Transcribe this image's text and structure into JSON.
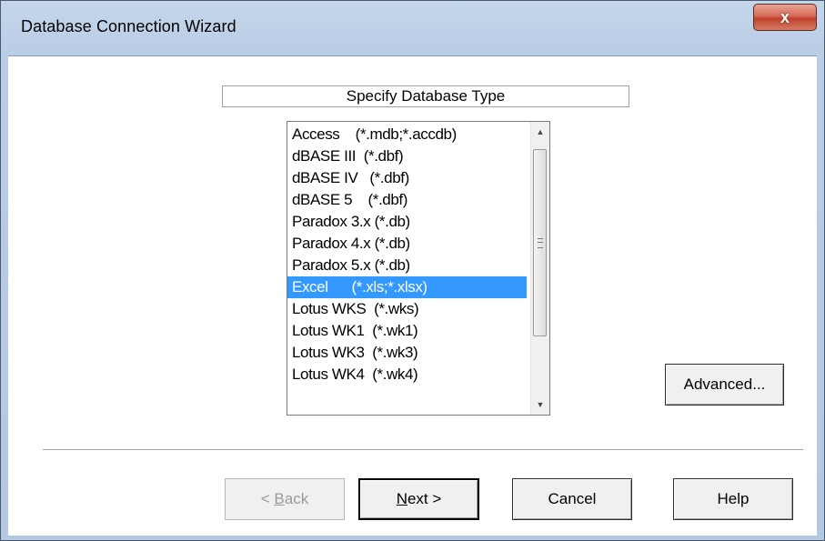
{
  "window": {
    "title": "Database Connection Wizard",
    "close_label": "x"
  },
  "step": {
    "heading": "Specify Database Type"
  },
  "db_types": [
    "Access    (*.mdb;*.accdb)",
    "dBASE III  (*.dbf)",
    "dBASE IV   (*.dbf)",
    "dBASE 5    (*.dbf)",
    "Paradox 3.x (*.db)",
    "Paradox 4.x (*.db)",
    "Paradox 5.x (*.db)",
    "Excel      (*.xls;*.xlsx)",
    "Lotus WKS  (*.wks)",
    "Lotus WK1  (*.wk1)",
    "Lotus WK3  (*.wk3)",
    "Lotus WK4  (*.wk4)"
  ],
  "selected_index": 7,
  "scrollbar": {
    "up_icon": "triangle-up",
    "down_icon": "triangle-down",
    "grip_icon": "grip-lines"
  },
  "buttons": {
    "advanced": "Advanced...",
    "back_prefix": "< ",
    "back_mnemonic": "B",
    "back_rest": "ack",
    "next_mnemonic": "N",
    "next_rest": "ext >",
    "cancel": "Cancel",
    "help": "Help"
  },
  "colors": {
    "selection": "#3399ff",
    "close_button": "#c0422c"
  }
}
